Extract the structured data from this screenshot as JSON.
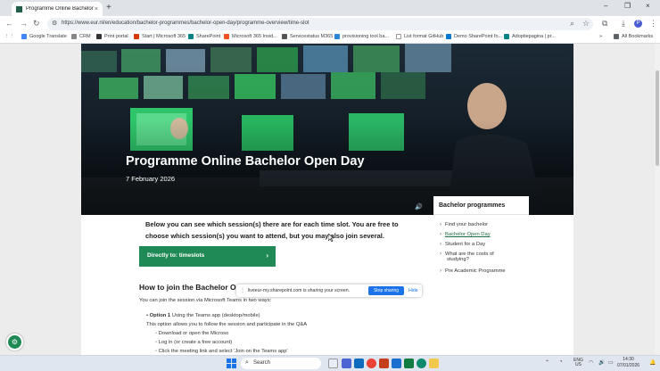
{
  "browser": {
    "tab_title": "Programme Online Bachelor Op",
    "tab_close": "×",
    "new_tab": "+",
    "url": "https://www.eur.nl/en/education/bachelor-programmes/bachelor-open-day/programme-overview/time-slot",
    "window": {
      "minimize": "–",
      "restore": "❐",
      "close": "×"
    },
    "avatar_letter": "P"
  },
  "bookmarks": [
    {
      "label": "Google Translate",
      "color": "#4285f4"
    },
    {
      "label": "CRM",
      "color": "#888888"
    },
    {
      "label": "Print portal",
      "color": "#333333"
    },
    {
      "label": "Start | Microsoft 365",
      "color": "#d83b01"
    },
    {
      "label": "SharePoint",
      "color": "#038387"
    },
    {
      "label": "Microsoft 365 Insid...",
      "color": "#f25022"
    },
    {
      "label": "Servicestatus M365",
      "color": "#555555"
    },
    {
      "label": "provisioning tool ba...",
      "color": "#2b88d8"
    },
    {
      "label": "List format GitHub",
      "color": "#ffffff"
    },
    {
      "label": "Demo SharePoint fo...",
      "color": "#0078d4"
    },
    {
      "label": "Adoptiepagina | pr...",
      "color": "#038387"
    }
  ],
  "bookmarks_more": "»",
  "all_bookmarks": "All Bookmarks",
  "hero": {
    "title": "Programme Online Bachelor Open Day",
    "date": "7 February 2026"
  },
  "intro": "Below you can see which session(s) there are for each time slot. You are free to choose which session(s) you want to attend, but you may also join several.",
  "cta": {
    "label": "Directly to: timeslots",
    "chevron": "›"
  },
  "section": {
    "heading": "How to join the Bachelor Open Day online sessions",
    "lead": "You can join the session via Microsoft Teams in two ways:",
    "option1_label": "Option 1",
    "option1_text": "Using the Teams app (desktop/mobile)",
    "option1_desc": "This option allows you to follow the session and participate in the Q&A",
    "bullets": [
      "Download or open the Microso",
      "Log in (or create a free account)",
      "Click the meeting link and select 'Join on the Teams app'"
    ]
  },
  "sidebar": {
    "title": "Bachelor programmes",
    "items": [
      {
        "label": "Find your bachelor",
        "active": false
      },
      {
        "label": "Bachelor Open Day",
        "active": true
      },
      {
        "label": "Student for a Day",
        "active": false
      },
      {
        "label": "What are the costs of",
        "label2": "studying?",
        "active": false
      },
      {
        "label": "Pre Academic Programme",
        "active": false
      }
    ]
  },
  "share_bar": {
    "text": "liveeur-my.sharepoint.com is sharing your screen.",
    "stop": "Stop sharing",
    "hide": "Hide"
  },
  "taskbar": {
    "search": "Search",
    "lang": "ENG",
    "region": "US",
    "time": "14:30",
    "date": "07/01/2026"
  }
}
